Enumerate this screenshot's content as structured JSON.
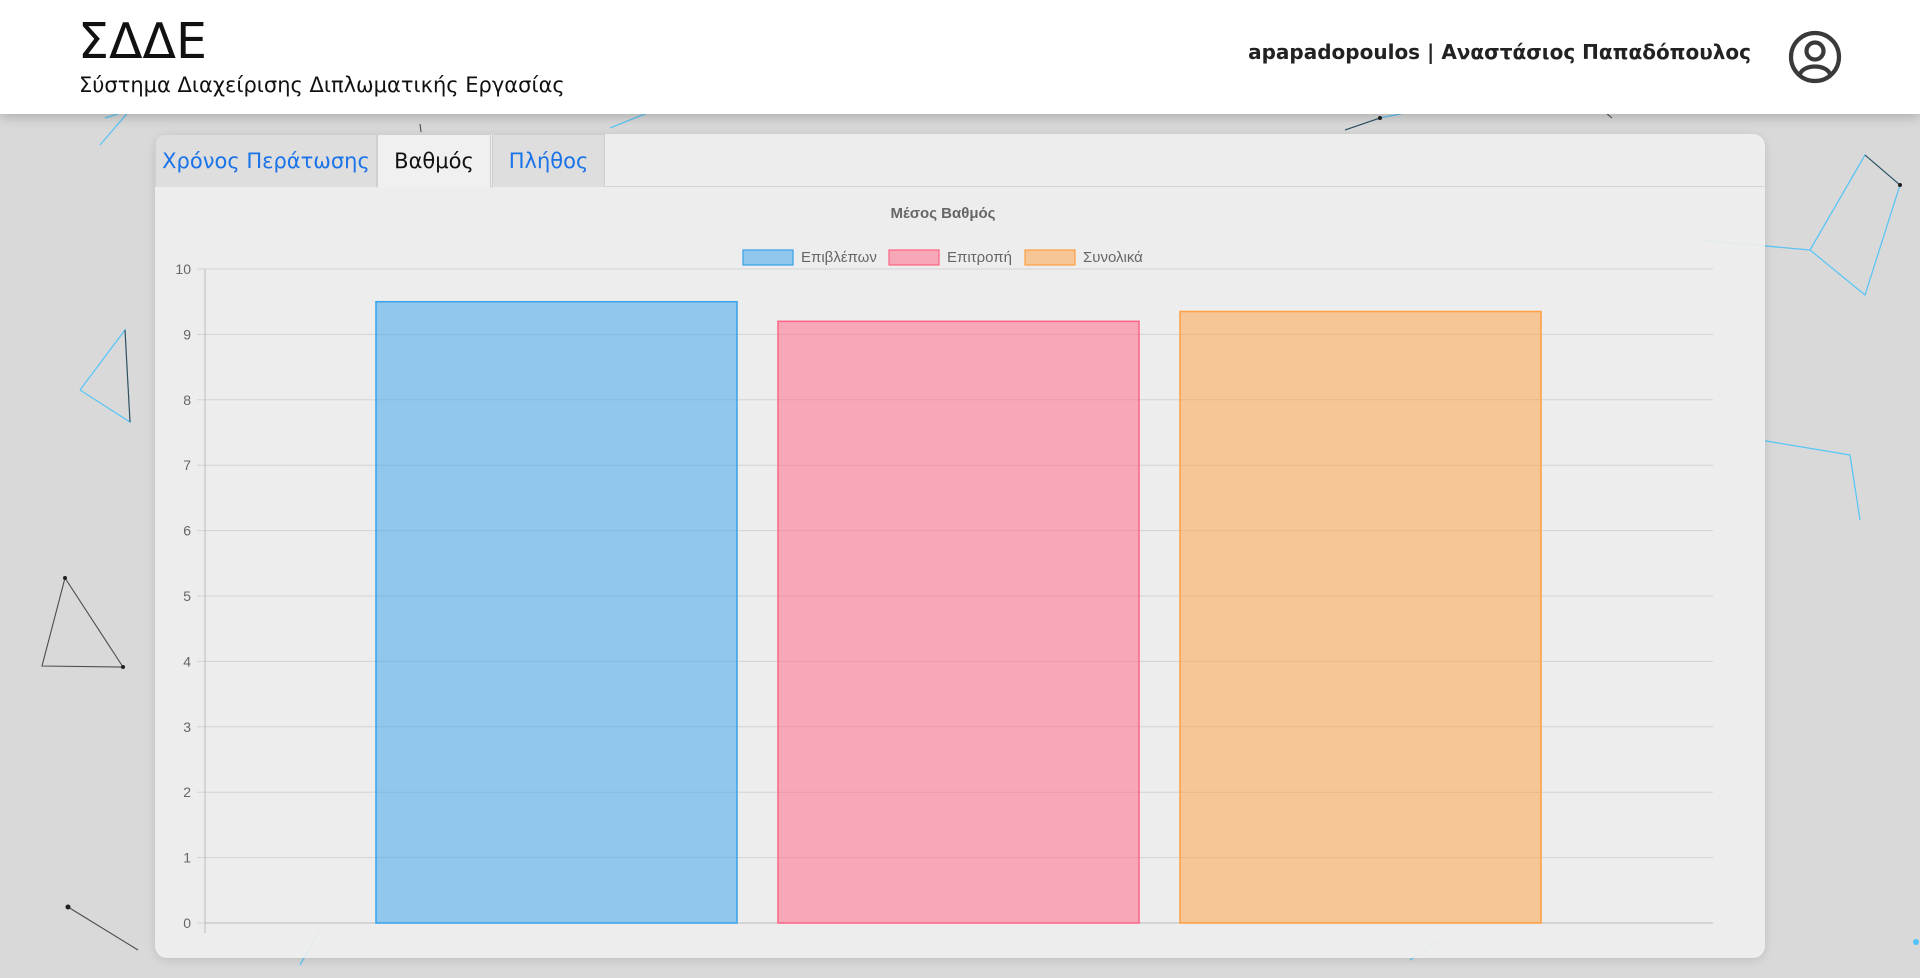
{
  "header": {
    "title": "ΣΔΔΕ",
    "subtitle": "Σύστημα Διαχείρισης Διπλωματικής Εργασίας",
    "user": "apapadopoulos | Αναστάσιος Παπαδόπουλος",
    "avatar_icon": "user-circle-icon"
  },
  "tabs": [
    {
      "label": "Χρόνος Περάτωσης",
      "active": false
    },
    {
      "label": "Βαθμός",
      "active": true
    },
    {
      "label": "Πλήθος",
      "active": false
    }
  ],
  "chart_data": {
    "type": "bar",
    "title": "Μέσος Βαθμός",
    "xlabel": "",
    "ylabel": "",
    "ylim": [
      0,
      10
    ],
    "yticks": [
      "0",
      "1",
      "2",
      "3",
      "4",
      "5",
      "6",
      "7",
      "8",
      "9",
      "10"
    ],
    "grid": true,
    "legend_position": "top",
    "series": [
      {
        "name": "Επιβλέπων",
        "value": 9.5,
        "color": "#36a2eb"
      },
      {
        "name": "Επιτροπή",
        "value": 9.2,
        "color": "#ff6384"
      },
      {
        "name": "Συνολικά",
        "value": 9.35,
        "color": "#ff9f40"
      }
    ]
  }
}
